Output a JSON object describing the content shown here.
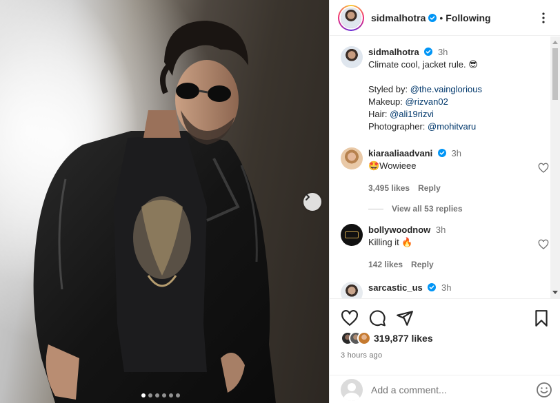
{
  "post": {
    "username": "sidmalhotra",
    "follow_state": "Following",
    "separator": "•",
    "media_dots": 6,
    "active_dot": 0
  },
  "caption": {
    "username": "sidmalhotra",
    "time": "3h",
    "line1": "Climate cool, jacket rule. 😎",
    "styled_label": "Styled by: ",
    "styled_handle": "@the.vainglorious",
    "makeup_label": "Makeup: ",
    "makeup_handle": "@rizvan02",
    "hair_label": "Hair: ",
    "hair_handle": "@ali19rizvi",
    "photo_label": "Photographer: ",
    "photo_handle": "@mohitvaru"
  },
  "comments": [
    {
      "username": "kiaraaliaadvani",
      "verified": true,
      "time": "3h",
      "text": "🤩Wowieee",
      "likes": "3,495 likes",
      "reply": "Reply"
    },
    {
      "username": "bollywoodnow",
      "verified": false,
      "time": "3h",
      "text": "Killing it 🔥",
      "likes": "142 likes",
      "reply": "Reply"
    },
    {
      "username": "sarcastic_us",
      "verified": true,
      "time": "3h"
    }
  ],
  "view_replies": "View all 53 replies",
  "footer": {
    "likes": "319,877 likes",
    "time_ago": "3 hours ago",
    "comment_placeholder": "Add a comment..."
  },
  "colors": {
    "verified": "#0095f6",
    "link": "#00376b",
    "muted": "#737373"
  }
}
